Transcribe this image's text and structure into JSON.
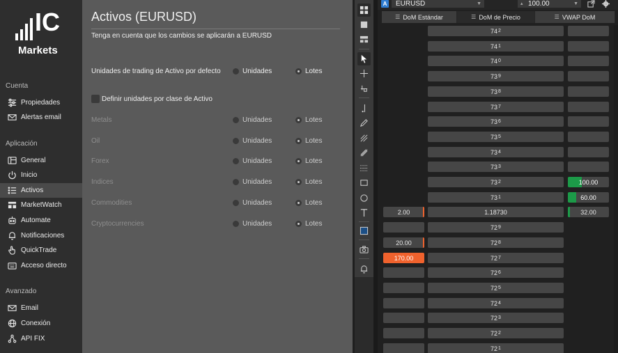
{
  "brand": {
    "logo_letters": "IC",
    "logo_word": "Markets"
  },
  "sidebar": {
    "sections": [
      {
        "label": "Cuenta"
      },
      {
        "label": "Aplicación"
      },
      {
        "label": "Avanzado"
      }
    ],
    "items": [
      {
        "label": "Propiedades",
        "icon": "sliders-icon"
      },
      {
        "label": "Alertas email",
        "icon": "envelope-icon"
      },
      {
        "label": "General",
        "icon": "window-icon"
      },
      {
        "label": "Inicio",
        "icon": "power-icon"
      },
      {
        "label": "Activos",
        "icon": "list-icon",
        "active": true
      },
      {
        "label": "MarketWatch",
        "icon": "marketwatch-icon"
      },
      {
        "label": "Automate",
        "icon": "robot-icon"
      },
      {
        "label": "Notificaciones",
        "icon": "bell-icon"
      },
      {
        "label": "QuickTrade",
        "icon": "hand-pointer-icon"
      },
      {
        "label": "Acceso directo",
        "icon": "keyboard-icon"
      },
      {
        "label": "Email",
        "icon": "email-icon"
      },
      {
        "label": "Conexión",
        "icon": "globe-icon"
      },
      {
        "label": "API FIX",
        "icon": "network-icon"
      }
    ]
  },
  "panel": {
    "title": "Activos (EURUSD)",
    "note": "Tenga en cuenta que los cambios se aplicarán a EURUSD",
    "default_row": {
      "label": "Unidades de trading de Activo por defecto",
      "opt1": "Unidades",
      "opt2": "Lotes",
      "selected": "Lotes"
    },
    "checkbox_label": "Definir unidades por clase de Activo",
    "classes": [
      {
        "label": "Metals",
        "opt1": "Unidades",
        "opt2": "Lotes"
      },
      {
        "label": "Oil",
        "opt1": "Unidades",
        "opt2": "Lotes"
      },
      {
        "label": "Forex",
        "opt1": "Unidades",
        "opt2": "Lotes"
      },
      {
        "label": "Indices",
        "opt1": "Unidades",
        "opt2": "Lotes"
      },
      {
        "label": "Commodities",
        "opt1": "Unidades",
        "opt2": "Lotes"
      },
      {
        "label": "Cryptocurrencies",
        "opt1": "Unidades",
        "opt2": "Lotes"
      }
    ]
  },
  "dom": {
    "symbol_badge": "A",
    "symbol": "EURUSD",
    "volume": "100.00",
    "tabs": [
      "DoM Estándar",
      "DoM de Precio",
      "VWAP DoM"
    ],
    "active_tab": 1,
    "rows": [
      {
        "price": "74",
        "sub": "2",
        "bid": "",
        "ask": ""
      },
      {
        "price": "74",
        "sub": "1",
        "bid": "",
        "ask": ""
      },
      {
        "price": "74",
        "sub": "0",
        "bid": "",
        "ask": ""
      },
      {
        "price": "73",
        "sub": "9",
        "bid": "",
        "ask": ""
      },
      {
        "price": "73",
        "sub": "8",
        "bid": "",
        "ask": ""
      },
      {
        "price": "73",
        "sub": "7",
        "bid": "",
        "ask": ""
      },
      {
        "price": "73",
        "sub": "6",
        "bid": "",
        "ask": ""
      },
      {
        "price": "73",
        "sub": "5",
        "bid": "",
        "ask": ""
      },
      {
        "price": "73",
        "sub": "4",
        "bid": "",
        "ask": ""
      },
      {
        "price": "73",
        "sub": "3",
        "bid": "",
        "ask": ""
      },
      {
        "price": "73",
        "sub": "2",
        "bid": "",
        "ask": "100.00"
      },
      {
        "price": "73",
        "sub": "1",
        "bid": "",
        "ask": "60.00"
      },
      {
        "price": "1.18730",
        "sub": "",
        "bid": "2.00",
        "ask": "32.00"
      },
      {
        "price": "72",
        "sub": "9",
        "bid": "",
        "ask": ""
      },
      {
        "price": "72",
        "sub": "8",
        "bid": "20.00",
        "ask": ""
      },
      {
        "price": "72",
        "sub": "7",
        "bid": "170.00",
        "ask": ""
      },
      {
        "price": "72",
        "sub": "6",
        "bid": "",
        "ask": ""
      },
      {
        "price": "72",
        "sub": "5",
        "bid": "",
        "ask": ""
      },
      {
        "price": "72",
        "sub": "4",
        "bid": "",
        "ask": ""
      },
      {
        "price": "72",
        "sub": "3",
        "bid": "",
        "ask": ""
      },
      {
        "price": "72",
        "sub": "2",
        "bid": "",
        "ask": ""
      },
      {
        "price": "72",
        "sub": "1",
        "bid": "",
        "ask": ""
      }
    ]
  },
  "colors": {
    "sell_accent": "#f0622d",
    "buy_accent": "#1c9a48",
    "symbol_badge": "#2f7dd1"
  }
}
